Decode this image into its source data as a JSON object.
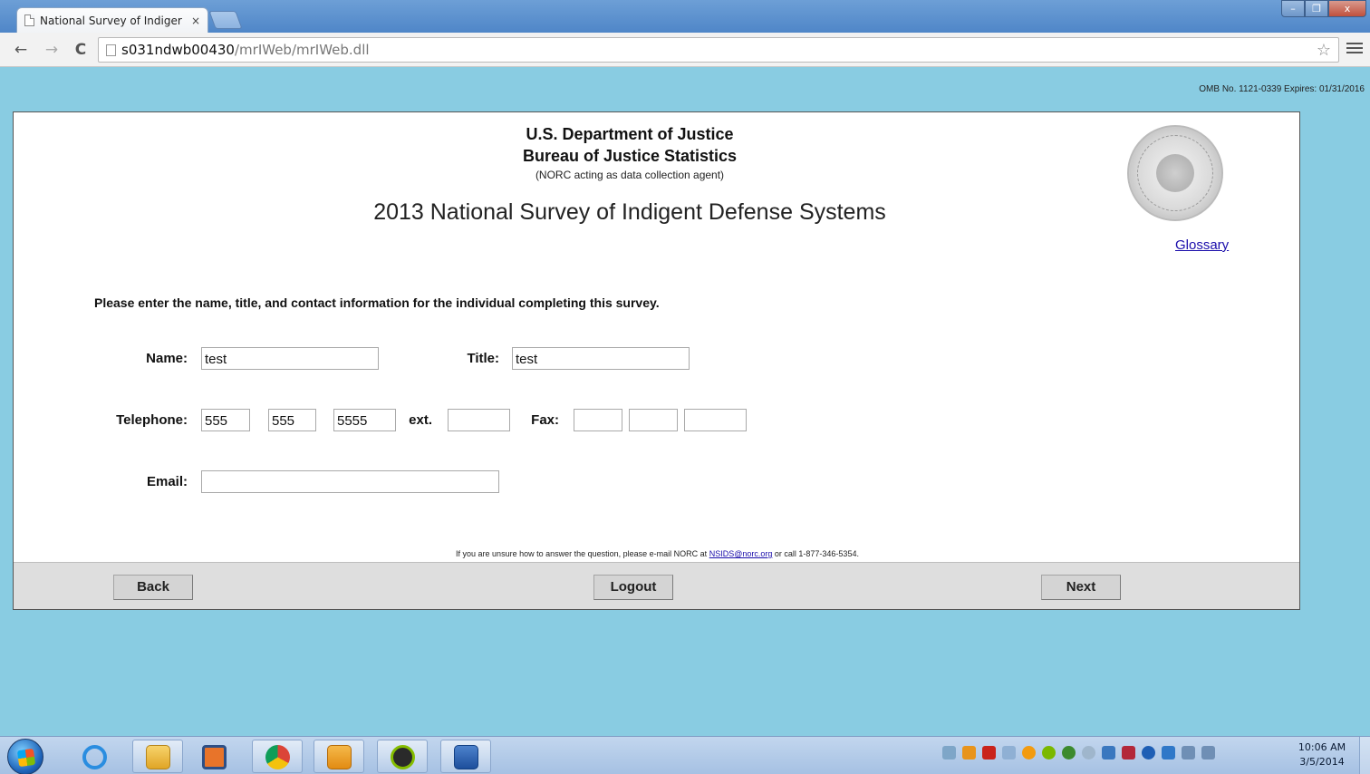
{
  "browser": {
    "tab_title": "National Survey of Indiger",
    "tab_close": "×",
    "url_host": "s031ndwb00430",
    "url_path": "/mrIWeb/mrIWeb.dll",
    "back_glyph": "←",
    "forward_glyph": "→",
    "reload_glyph": "C",
    "star_glyph": "☆",
    "win_minimize": "–",
    "win_restore": "❐",
    "win_close": "x"
  },
  "page": {
    "omb": "OMB No. 1121-0339 Expires: 01/31/2016",
    "agency_line1": "U.S. Department of Justice",
    "agency_line2": "Bureau of Justice Statistics",
    "agency_line3": "(NORC acting as data collection agent)",
    "survey_title": "2013 National Survey of Indigent Defense Systems",
    "glossary": "Glossary",
    "instructions": "Please enter the name, title, and contact information for the individual completing this survey.",
    "form": {
      "name_label": "Name:",
      "name_value": "test",
      "title_label": "Title:",
      "title_value": "test",
      "telephone_label": "Telephone:",
      "phone_area": "555",
      "phone_prefix": "555",
      "phone_line": "5555",
      "ext_label": "ext.",
      "ext_value": "",
      "fax_label": "Fax:",
      "fax_area": "",
      "fax_prefix": "",
      "fax_line": "",
      "email_label": "Email:",
      "email_value": ""
    },
    "help_prefix": "If you are unsure how to answer the question, please e-mail NORC at",
    "help_email": "NSIDS@norc.org",
    "help_suffix": "or call 1-877-346-5354.",
    "buttons": {
      "back": "Back",
      "logout": "Logout",
      "next": "Next"
    }
  },
  "taskbar": {
    "clock_time": "10:06 AM",
    "clock_date": "3/5/2014"
  }
}
